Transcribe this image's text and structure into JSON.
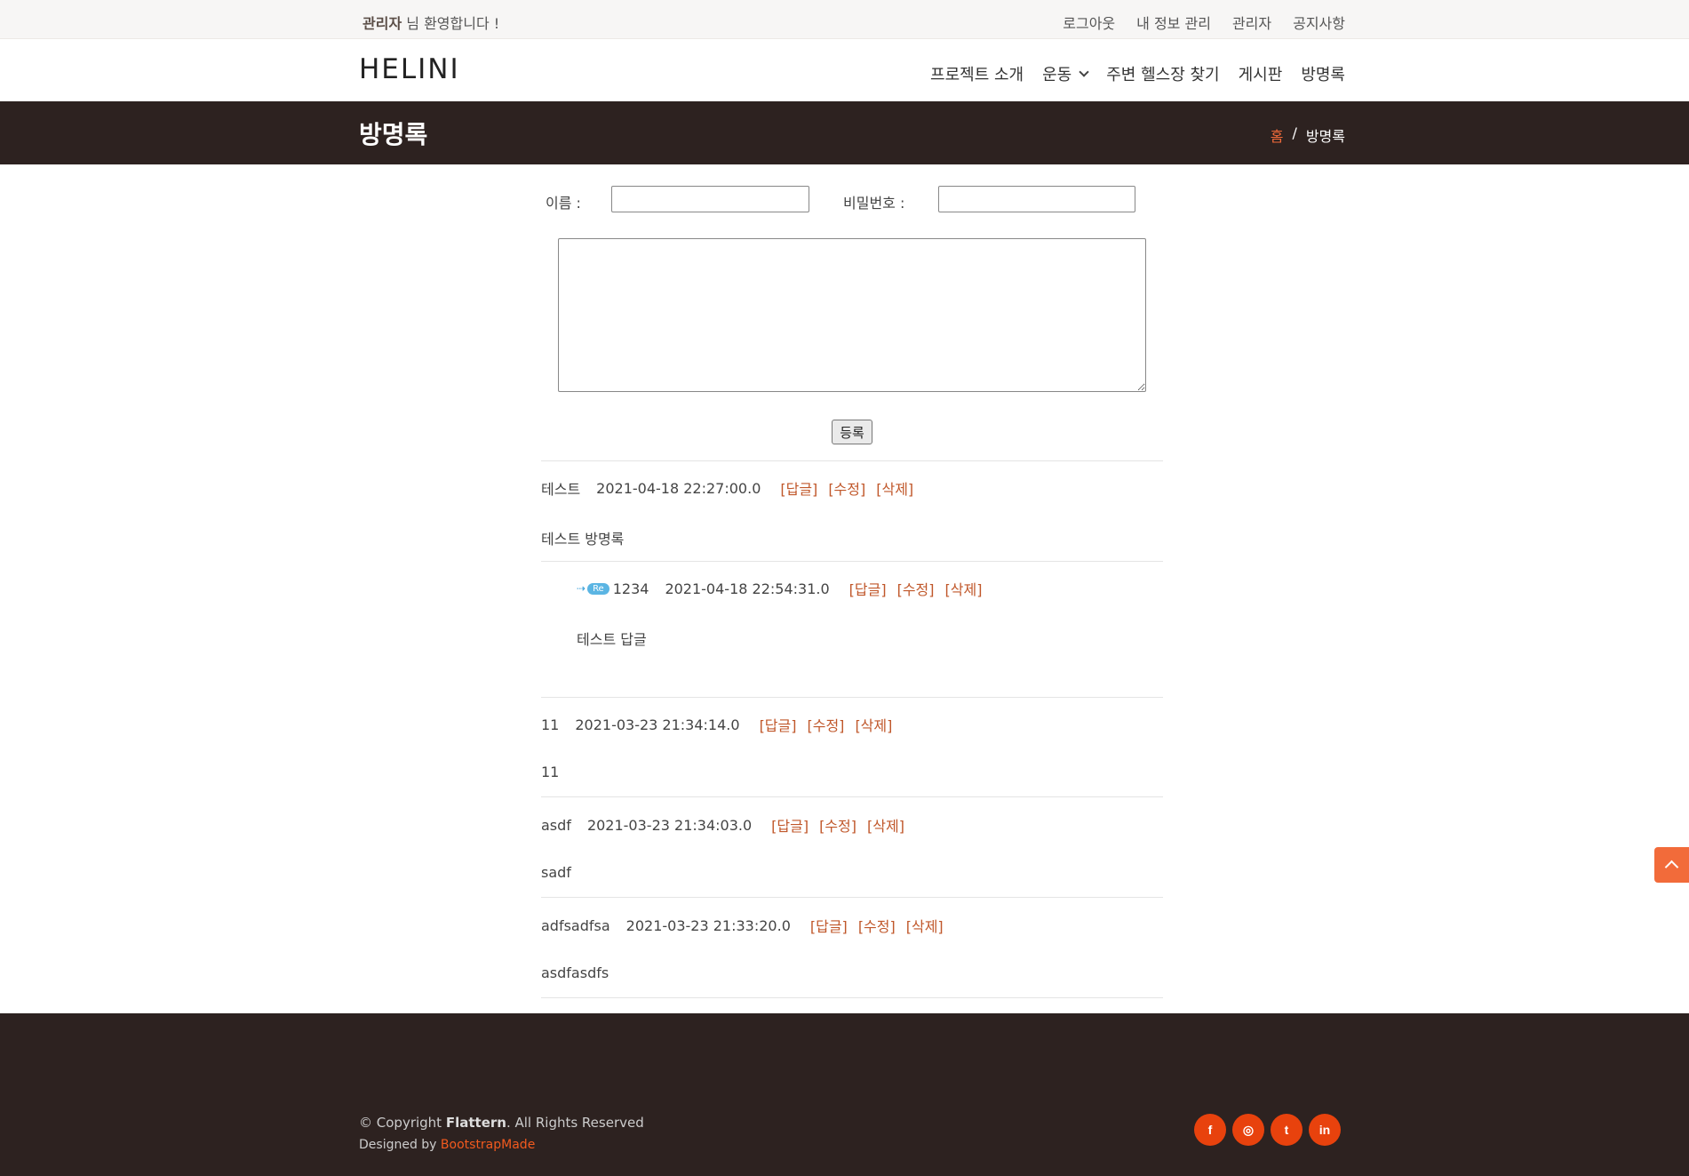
{
  "topbar": {
    "welcome_user": "관리자",
    "welcome_suffix": " 님 환영합니다 !",
    "links": [
      "로그아웃",
      "내 정보 관리",
      "관리자",
      "공지사항"
    ]
  },
  "header": {
    "logo": "HELINI",
    "nav": [
      "프로젝트 소개",
      "운동",
      "주변 헬스장 찾기",
      "게시판",
      "방명록"
    ]
  },
  "band": {
    "title": "방명록",
    "breadcrumb_home": "홈",
    "breadcrumb_sep": "/",
    "breadcrumb_current": "방명록"
  },
  "form": {
    "name_label": "이름 :",
    "name_value": "",
    "password_label": "비밀번호 :",
    "password_value": "",
    "submit_label": "등록"
  },
  "actions": {
    "reply": "[답글]",
    "edit": "[수정]",
    "delete": "[삭제]"
  },
  "entries": [
    {
      "name": "테스트",
      "date": "2021-04-18 22:27:00.0",
      "content": "테스트 방명록"
    },
    {
      "name": "1234",
      "date": "2021-04-18 22:54:31.0",
      "content": "테스트 답글",
      "is_reply": true,
      "reply_badge": "Re"
    },
    {
      "name": "11",
      "date": "2021-03-23 21:34:14.0",
      "content": "11"
    },
    {
      "name": "asdf",
      "date": "2021-03-23 21:34:03.0",
      "content": "sadf"
    },
    {
      "name": "adfsadfsa",
      "date": "2021-03-23 21:33:20.0",
      "content": "asdfasdfs"
    }
  ],
  "footer": {
    "copyright_prefix": "© Copyright ",
    "copyright_brand": "Flattern",
    "copyright_suffix": ". All Rights Reserved",
    "designed_prefix": "Designed by ",
    "designed_link": "BootstrapMade",
    "social": [
      {
        "icon": "facebook-icon",
        "glyph": "f"
      },
      {
        "icon": "instagram-icon",
        "glyph": "◎"
      },
      {
        "icon": "twitter-icon",
        "glyph": "t"
      },
      {
        "icon": "linkedin-icon",
        "glyph": "in"
      }
    ]
  },
  "colors": {
    "accent": "#f26b3a",
    "dark_band": "#2d2220",
    "action_link": "#c0572a",
    "social_bg": "#e8420d"
  }
}
